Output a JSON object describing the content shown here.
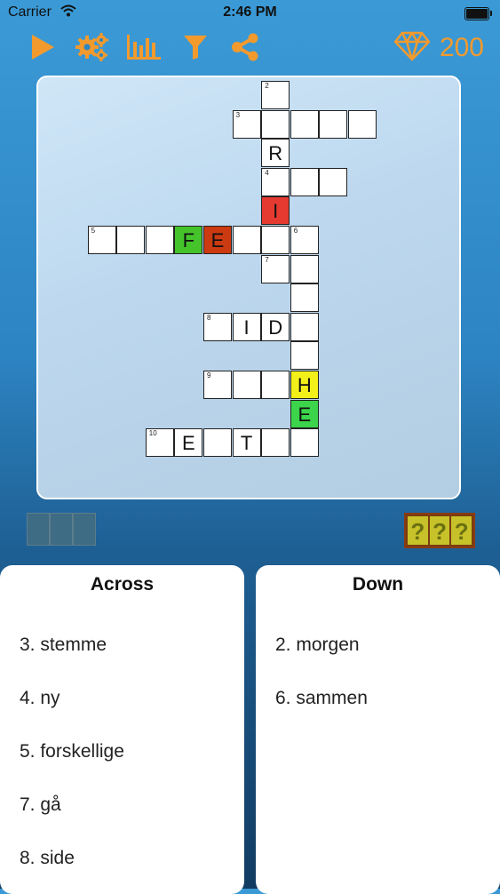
{
  "status": {
    "carrier": "Carrier",
    "time": "2:46 PM"
  },
  "toolbar": {
    "icons": [
      "play-icon",
      "settings-gears-icon",
      "stats-icon",
      "filter-icon",
      "share-icon"
    ],
    "accent": "#f29a2e",
    "gems_icon": "diamond-icon",
    "gems": "200"
  },
  "board": {
    "cells": [
      {
        "row": 0,
        "col": 7,
        "num": "2",
        "letter": ""
      },
      {
        "row": 1,
        "col": 6,
        "num": "3",
        "letter": ""
      },
      {
        "row": 1,
        "col": 7,
        "num": "",
        "letter": ""
      },
      {
        "row": 1,
        "col": 8,
        "num": "",
        "letter": ""
      },
      {
        "row": 1,
        "col": 9,
        "num": "",
        "letter": ""
      },
      {
        "row": 1,
        "col": 10,
        "num": "",
        "letter": ""
      },
      {
        "row": 2,
        "col": 7,
        "num": "",
        "letter": "R"
      },
      {
        "row": 3,
        "col": 7,
        "num": "4",
        "letter": ""
      },
      {
        "row": 3,
        "col": 8,
        "num": "",
        "letter": ""
      },
      {
        "row": 3,
        "col": 9,
        "num": "",
        "letter": ""
      },
      {
        "row": 4,
        "col": 7,
        "num": "",
        "letter": "I",
        "color": "red"
      },
      {
        "row": 5,
        "col": 1,
        "num": "5",
        "letter": ""
      },
      {
        "row": 5,
        "col": 2,
        "num": "",
        "letter": ""
      },
      {
        "row": 5,
        "col": 3,
        "num": "",
        "letter": ""
      },
      {
        "row": 5,
        "col": 4,
        "num": "",
        "letter": "F",
        "color": "green"
      },
      {
        "row": 5,
        "col": 5,
        "num": "",
        "letter": "E",
        "color": "darkred"
      },
      {
        "row": 5,
        "col": 6,
        "num": "",
        "letter": ""
      },
      {
        "row": 5,
        "col": 7,
        "num": "",
        "letter": ""
      },
      {
        "row": 5,
        "col": 8,
        "num": "6",
        "letter": ""
      },
      {
        "row": 6,
        "col": 7,
        "num": "7",
        "letter": ""
      },
      {
        "row": 6,
        "col": 8,
        "num": "",
        "letter": ""
      },
      {
        "row": 7,
        "col": 8,
        "num": "",
        "letter": ""
      },
      {
        "row": 8,
        "col": 5,
        "num": "8",
        "letter": ""
      },
      {
        "row": 8,
        "col": 6,
        "num": "",
        "letter": "I"
      },
      {
        "row": 8,
        "col": 7,
        "num": "",
        "letter": "D"
      },
      {
        "row": 8,
        "col": 8,
        "num": "",
        "letter": ""
      },
      {
        "row": 9,
        "col": 8,
        "num": "",
        "letter": ""
      },
      {
        "row": 10,
        "col": 5,
        "num": "9",
        "letter": ""
      },
      {
        "row": 10,
        "col": 6,
        "num": "",
        "letter": ""
      },
      {
        "row": 10,
        "col": 7,
        "num": "",
        "letter": ""
      },
      {
        "row": 10,
        "col": 8,
        "num": "",
        "letter": "H",
        "color": "yellow"
      },
      {
        "row": 11,
        "col": 8,
        "num": "",
        "letter": "E",
        "color": "lgreen"
      },
      {
        "row": 12,
        "col": 3,
        "num": "10",
        "letter": ""
      },
      {
        "row": 12,
        "col": 4,
        "num": "",
        "letter": "E"
      },
      {
        "row": 12,
        "col": 5,
        "num": "",
        "letter": ""
      },
      {
        "row": 12,
        "col": 6,
        "num": "",
        "letter": "T"
      },
      {
        "row": 12,
        "col": 7,
        "num": "",
        "letter": ""
      },
      {
        "row": 12,
        "col": 8,
        "num": "",
        "letter": ""
      }
    ]
  },
  "letter_slots": 3,
  "hint": {
    "marks": [
      "?",
      "?",
      "?"
    ]
  },
  "across": {
    "title": "Across",
    "clues": [
      "3. stemme",
      "4. ny",
      "5. forskellige",
      "7. gå",
      "8. side"
    ]
  },
  "down": {
    "title": "Down",
    "clues": [
      "2. morgen",
      "6. sammen"
    ]
  }
}
